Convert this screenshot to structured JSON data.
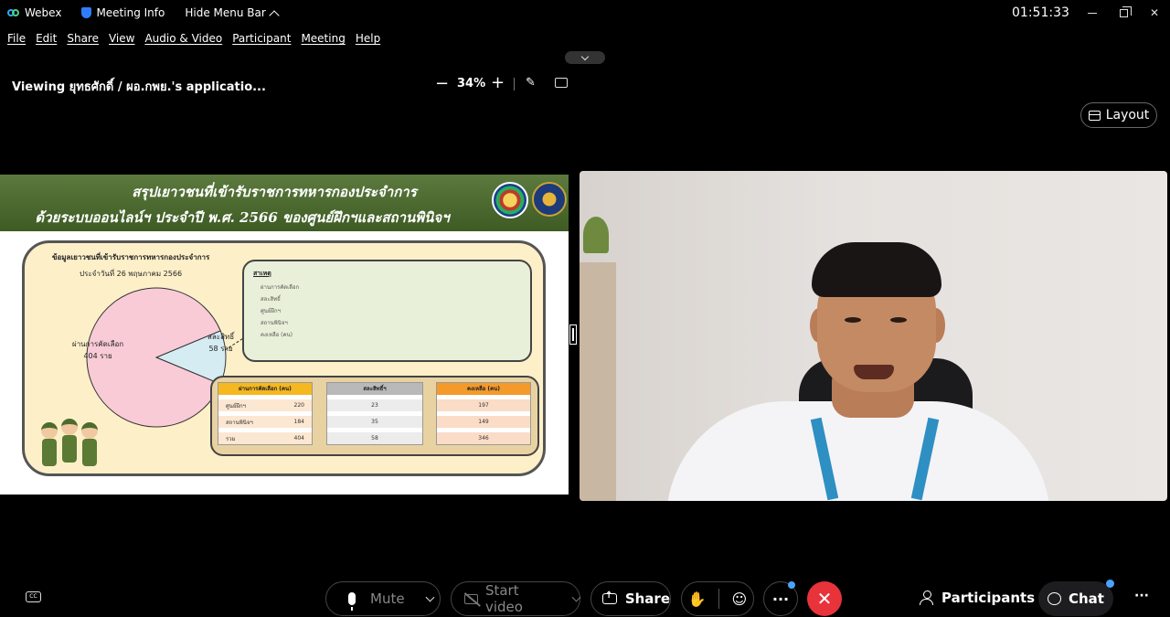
{
  "titlebar": {
    "app_name": "Webex",
    "meeting_info": "Meeting Info",
    "hide_menu_bar": "Hide Menu Bar",
    "clock": "01:51:33"
  },
  "menubar": {
    "items": [
      "File",
      "Edit",
      "Share",
      "View",
      "Audio & Video",
      "Participant",
      "Meeting",
      "Help"
    ]
  },
  "viewbar": {
    "viewing_label": "Viewing ยุทธศักดิ์ / ผอ.กพย.'s applicatio...",
    "zoom_minus": "−",
    "zoom_level": "34%",
    "zoom_plus": "+"
  },
  "slide": {
    "title_line1": "สรุปเยาวชนที่เข้ารับราชการทหารกองประจำการ",
    "title_line2": "ด้วยระบบออนไลน์ฯ ประจำปี พ.ศ. 2566 ของศูนย์ฝึกฯและสถานพินิจฯ",
    "chart_heading": "ข้อมูลเยาวชนที่เข้ารับราชการทหารกองประจำการ",
    "chart_date": "ประจำวันที่ 26 พฤษภาคม 2566",
    "notes_title": "สาเหตุ",
    "notes_lines": [
      "ผ่านการคัดเลือก",
      "สละสิทธิ์",
      "ศูนย์ฝึกฯ",
      "สถานพินิจฯ",
      "คงเหลือ (คน)"
    ],
    "tables": [
      {
        "header": "ผ่านการคัดเลือก (คน)",
        "header_color": "#f5b820",
        "rows": [
          [
            "ศูนย์ฝึกฯ",
            "220"
          ],
          [
            "สถานพินิจฯ",
            "184"
          ],
          [
            "รวม",
            "404"
          ]
        ]
      },
      {
        "header": "สละสิทธิ์ฯ",
        "header_color": "#b9b9b9",
        "rows": [
          [
            "",
            "23"
          ],
          [
            "",
            "35"
          ],
          [
            "",
            "58"
          ]
        ]
      },
      {
        "header": "คงเหลือ (คน)",
        "header_color": "#f39a2b",
        "rows": [
          [
            "",
            "197"
          ],
          [
            "",
            "149"
          ],
          [
            "",
            "346"
          ]
        ]
      }
    ]
  },
  "chart_data": {
    "type": "pie",
    "title": "ข้อมูลเยาวชนที่เข้ารับราชการทหารกองประจำการ",
    "subtitle": "ประจำวันที่ 26 พฤษภาคม 2566",
    "slices": [
      {
        "label": "ผ่านการคัดเลือก",
        "value": 404,
        "value_label": "404 ราย",
        "color": "#f8cbd6"
      },
      {
        "label": "สละสิทธิ์",
        "value": 58,
        "value_label": "58 ราย",
        "color": "#d6ecf3"
      }
    ]
  },
  "layout_button": {
    "label": "Layout"
  },
  "controls": {
    "cc": "CC",
    "mute": "Mute",
    "start_video": "Start video",
    "share": "Share",
    "raise_hand": "✋",
    "reactions": "☺",
    "more": "···",
    "leave": "✕",
    "participants": "Participants",
    "chat": "Chat",
    "more_right": "···"
  },
  "colors": {
    "leave_red": "#e8333b",
    "notification_blue": "#4aa3ff",
    "slide_header_green": "#4a6a2e"
  }
}
